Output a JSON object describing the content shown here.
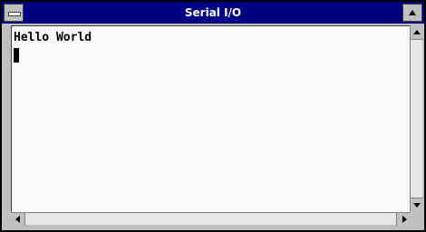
{
  "window": {
    "title": "Serial I/O"
  },
  "terminal": {
    "lines": [
      "Hello World"
    ]
  },
  "colors": {
    "titlebar": "#000080",
    "client_bg": "#f7f9f7",
    "frame": "#c0c0c0"
  },
  "icons": {
    "system_menu": "system-menu-icon",
    "maximize": "maximize-icon",
    "scroll_up": "scroll-up-icon",
    "scroll_down": "scroll-down-icon",
    "scroll_left": "scroll-left-icon",
    "scroll_right": "scroll-right-icon"
  }
}
